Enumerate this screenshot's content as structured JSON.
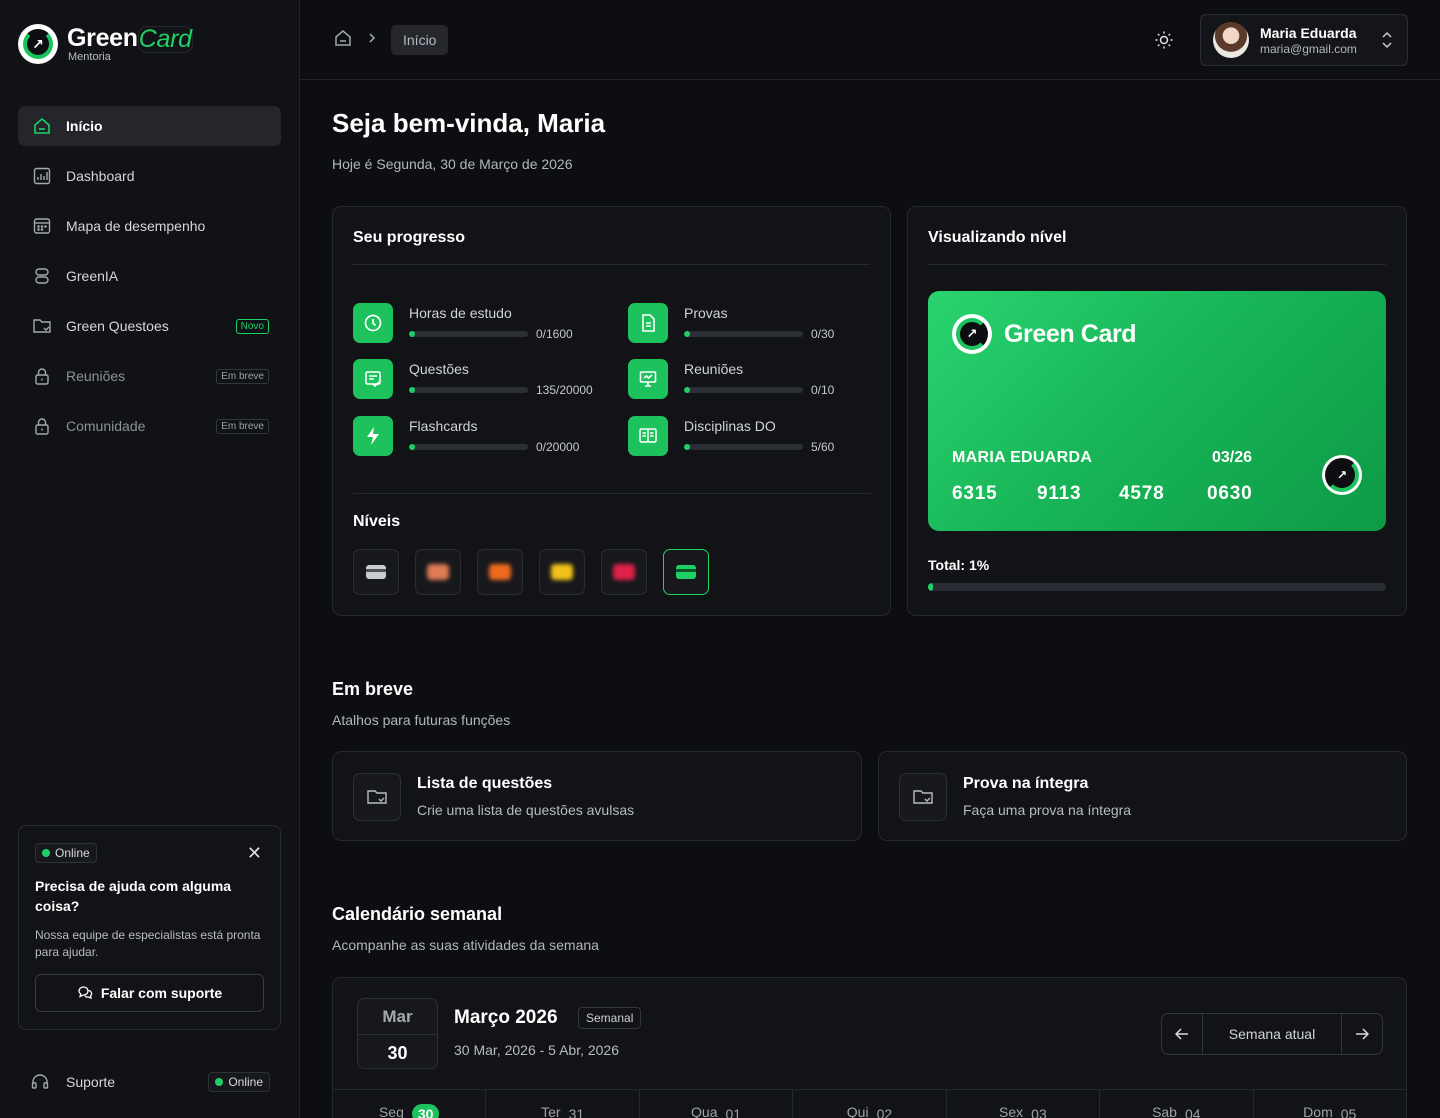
{
  "brand": {
    "name_a": "Green",
    "name_b": "Card",
    "subtitle": "Mentoria"
  },
  "sidebar": {
    "items": [
      {
        "label": "Início",
        "icon": "home-icon",
        "active": true
      },
      {
        "label": "Dashboard",
        "icon": "chart-icon"
      },
      {
        "label": "Mapa de desempenho",
        "icon": "calendar-grid-icon"
      },
      {
        "label": "GreenIA",
        "icon": "database-icon"
      },
      {
        "label": "Green Questoes",
        "icon": "folder-check-icon",
        "badge": "Novo"
      },
      {
        "label": "Reuniões",
        "icon": "lock-icon",
        "badge": "Em breve",
        "disabled": true
      },
      {
        "label": "Comunidade",
        "icon": "lock-icon",
        "badge": "Em breve",
        "disabled": true
      }
    ],
    "help": {
      "status": "Online",
      "title": "Precisa de ajuda com alguma coisa?",
      "text": "Nossa equipe de especialistas está pronta para ajudar.",
      "button": "Falar com suporte"
    },
    "support": {
      "label": "Suporte",
      "status": "Online"
    }
  },
  "topbar": {
    "breadcrumb": "Início",
    "user": {
      "name": "Maria Eduarda",
      "email": "maria@gmail.com"
    }
  },
  "welcome": {
    "title": "Seja bem-vinda, Maria",
    "date": "Hoje é Segunda, 30 de Março de 2026"
  },
  "progress": {
    "title": "Seu progresso",
    "stats": [
      {
        "label": "Horas de estudo",
        "value": "0/1600",
        "fraction": 0.05,
        "icon": "clock-icon"
      },
      {
        "label": "Provas",
        "value": "0/30",
        "fraction": 0.05,
        "icon": "document-icon"
      },
      {
        "label": "Questões",
        "value": "135/20000",
        "fraction": 0.05,
        "icon": "checklist-icon"
      },
      {
        "label": "Reuniões",
        "value": "0/10",
        "fraction": 0.05,
        "icon": "presentation-icon"
      },
      {
        "label": "Flashcards",
        "value": "0/20000",
        "fraction": 0.05,
        "icon": "bolt-icon"
      },
      {
        "label": "Disciplinas DO",
        "value": "5/60",
        "fraction": 0.05,
        "icon": "book-icon"
      }
    ],
    "levels_title": "Níveis",
    "levels": [
      {
        "color": "#c8cbd0",
        "kind": "card"
      },
      {
        "color": "#e07b54",
        "kind": "blob"
      },
      {
        "color": "#f06a1e",
        "kind": "blob"
      },
      {
        "color": "#f2c21a",
        "kind": "blob"
      },
      {
        "color": "#e0224a",
        "kind": "blob"
      },
      {
        "color": "#1fd066",
        "kind": "card",
        "selected": true
      }
    ]
  },
  "level_view": {
    "title": "Visualizando nível",
    "card_brand": "Green Card",
    "holder": "MARIA  EDUARDA",
    "expiry": "03/26",
    "numbers": [
      "6315",
      "9113",
      "4578",
      "0630"
    ],
    "total_label": "Total: 1%",
    "total_fraction": 0.01
  },
  "soon": {
    "title": "Em breve",
    "subtitle": "Atalhos para futuras funções",
    "items": [
      {
        "title": "Lista de questões",
        "subtitle": "Crie uma lista de questões avulsas"
      },
      {
        "title": "Prova na íntegra",
        "subtitle": "Faça uma prova na íntegra"
      }
    ]
  },
  "calendar": {
    "title": "Calendário semanal",
    "subtitle": "Acompanhe as suas atividades da semana",
    "month_short": "Mar",
    "day": "30",
    "month_title": "Março 2026",
    "mode": "Semanal",
    "range": "30 Mar, 2026 - 5 Abr, 2026",
    "current_week": "Semana atual",
    "days": [
      {
        "name": "Seg",
        "num": "30",
        "today": true
      },
      {
        "name": "Ter",
        "num": "31"
      },
      {
        "name": "Qua",
        "num": "01"
      },
      {
        "name": "Qui",
        "num": "02"
      },
      {
        "name": "Sex",
        "num": "03"
      },
      {
        "name": "Sab",
        "num": "04"
      },
      {
        "name": "Dom",
        "num": "05"
      }
    ]
  },
  "colors": {
    "accent": "#1fd066",
    "background": "#0d0e11",
    "panel": "#121317"
  }
}
